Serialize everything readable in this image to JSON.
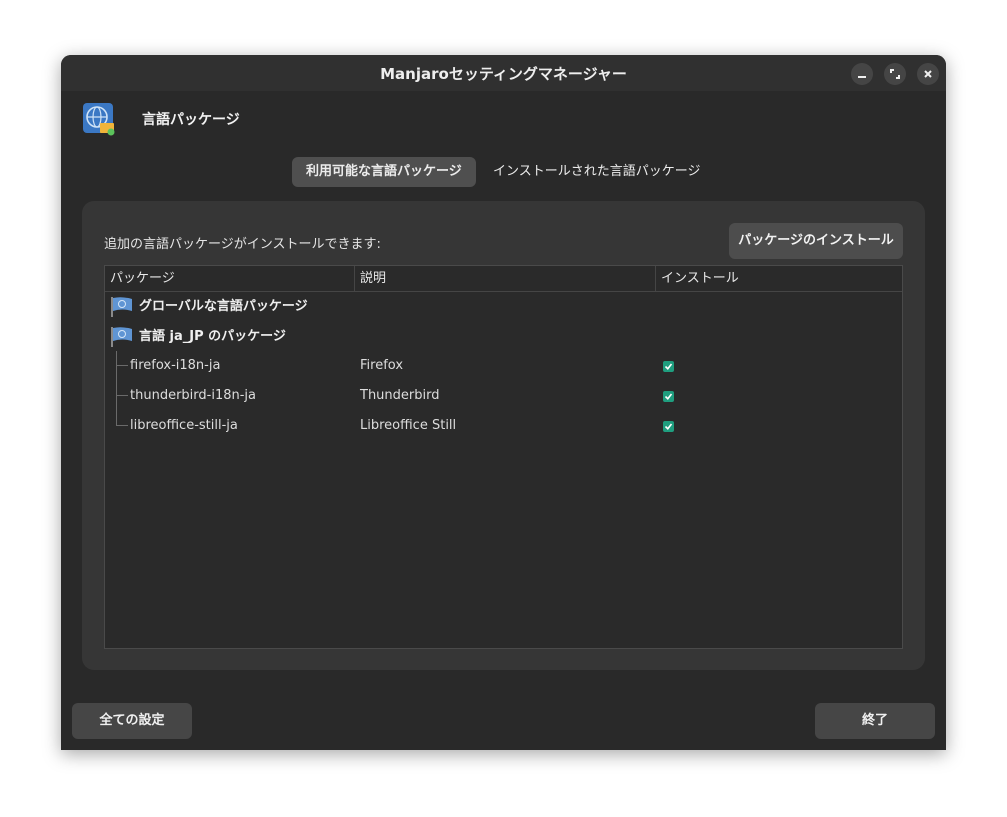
{
  "window": {
    "title": "Manjaroセッティングマネージャー",
    "controls": {
      "minimize": "minimize-icon",
      "maximize": "maximize-icon",
      "close": "close-icon"
    }
  },
  "header": {
    "icon": "language-globe-icon",
    "title": "言語パッケージ"
  },
  "tabs": [
    {
      "label": "利用可能な言語パッケージ",
      "active": true
    },
    {
      "label": "インストールされた言語パッケージ",
      "active": false
    }
  ],
  "panel": {
    "label": "追加の言語パッケージがインストールできます:",
    "install_button": "パッケージのインストール"
  },
  "tree": {
    "columns": [
      "パッケージ",
      "説明",
      "インストール"
    ],
    "groups": [
      {
        "label": "グローバルな言語パッケージ",
        "icon": "flag-icon",
        "items": []
      },
      {
        "label": "言語 ja_JP のパッケージ",
        "icon": "flag-icon",
        "items": [
          {
            "name": "firefox-i18n-ja",
            "description": "Firefox",
            "install": true
          },
          {
            "name": "thunderbird-i18n-ja",
            "description": "Thunderbird",
            "install": true
          },
          {
            "name": "libreoffice-still-ja",
            "description": "Libreoffice Still",
            "install": true
          }
        ]
      }
    ]
  },
  "footer": {
    "all_settings": "全ての設定",
    "quit": "終了"
  },
  "colors": {
    "background": "#292929",
    "panel": "#363636",
    "checkbox": "#1f9e7f"
  }
}
